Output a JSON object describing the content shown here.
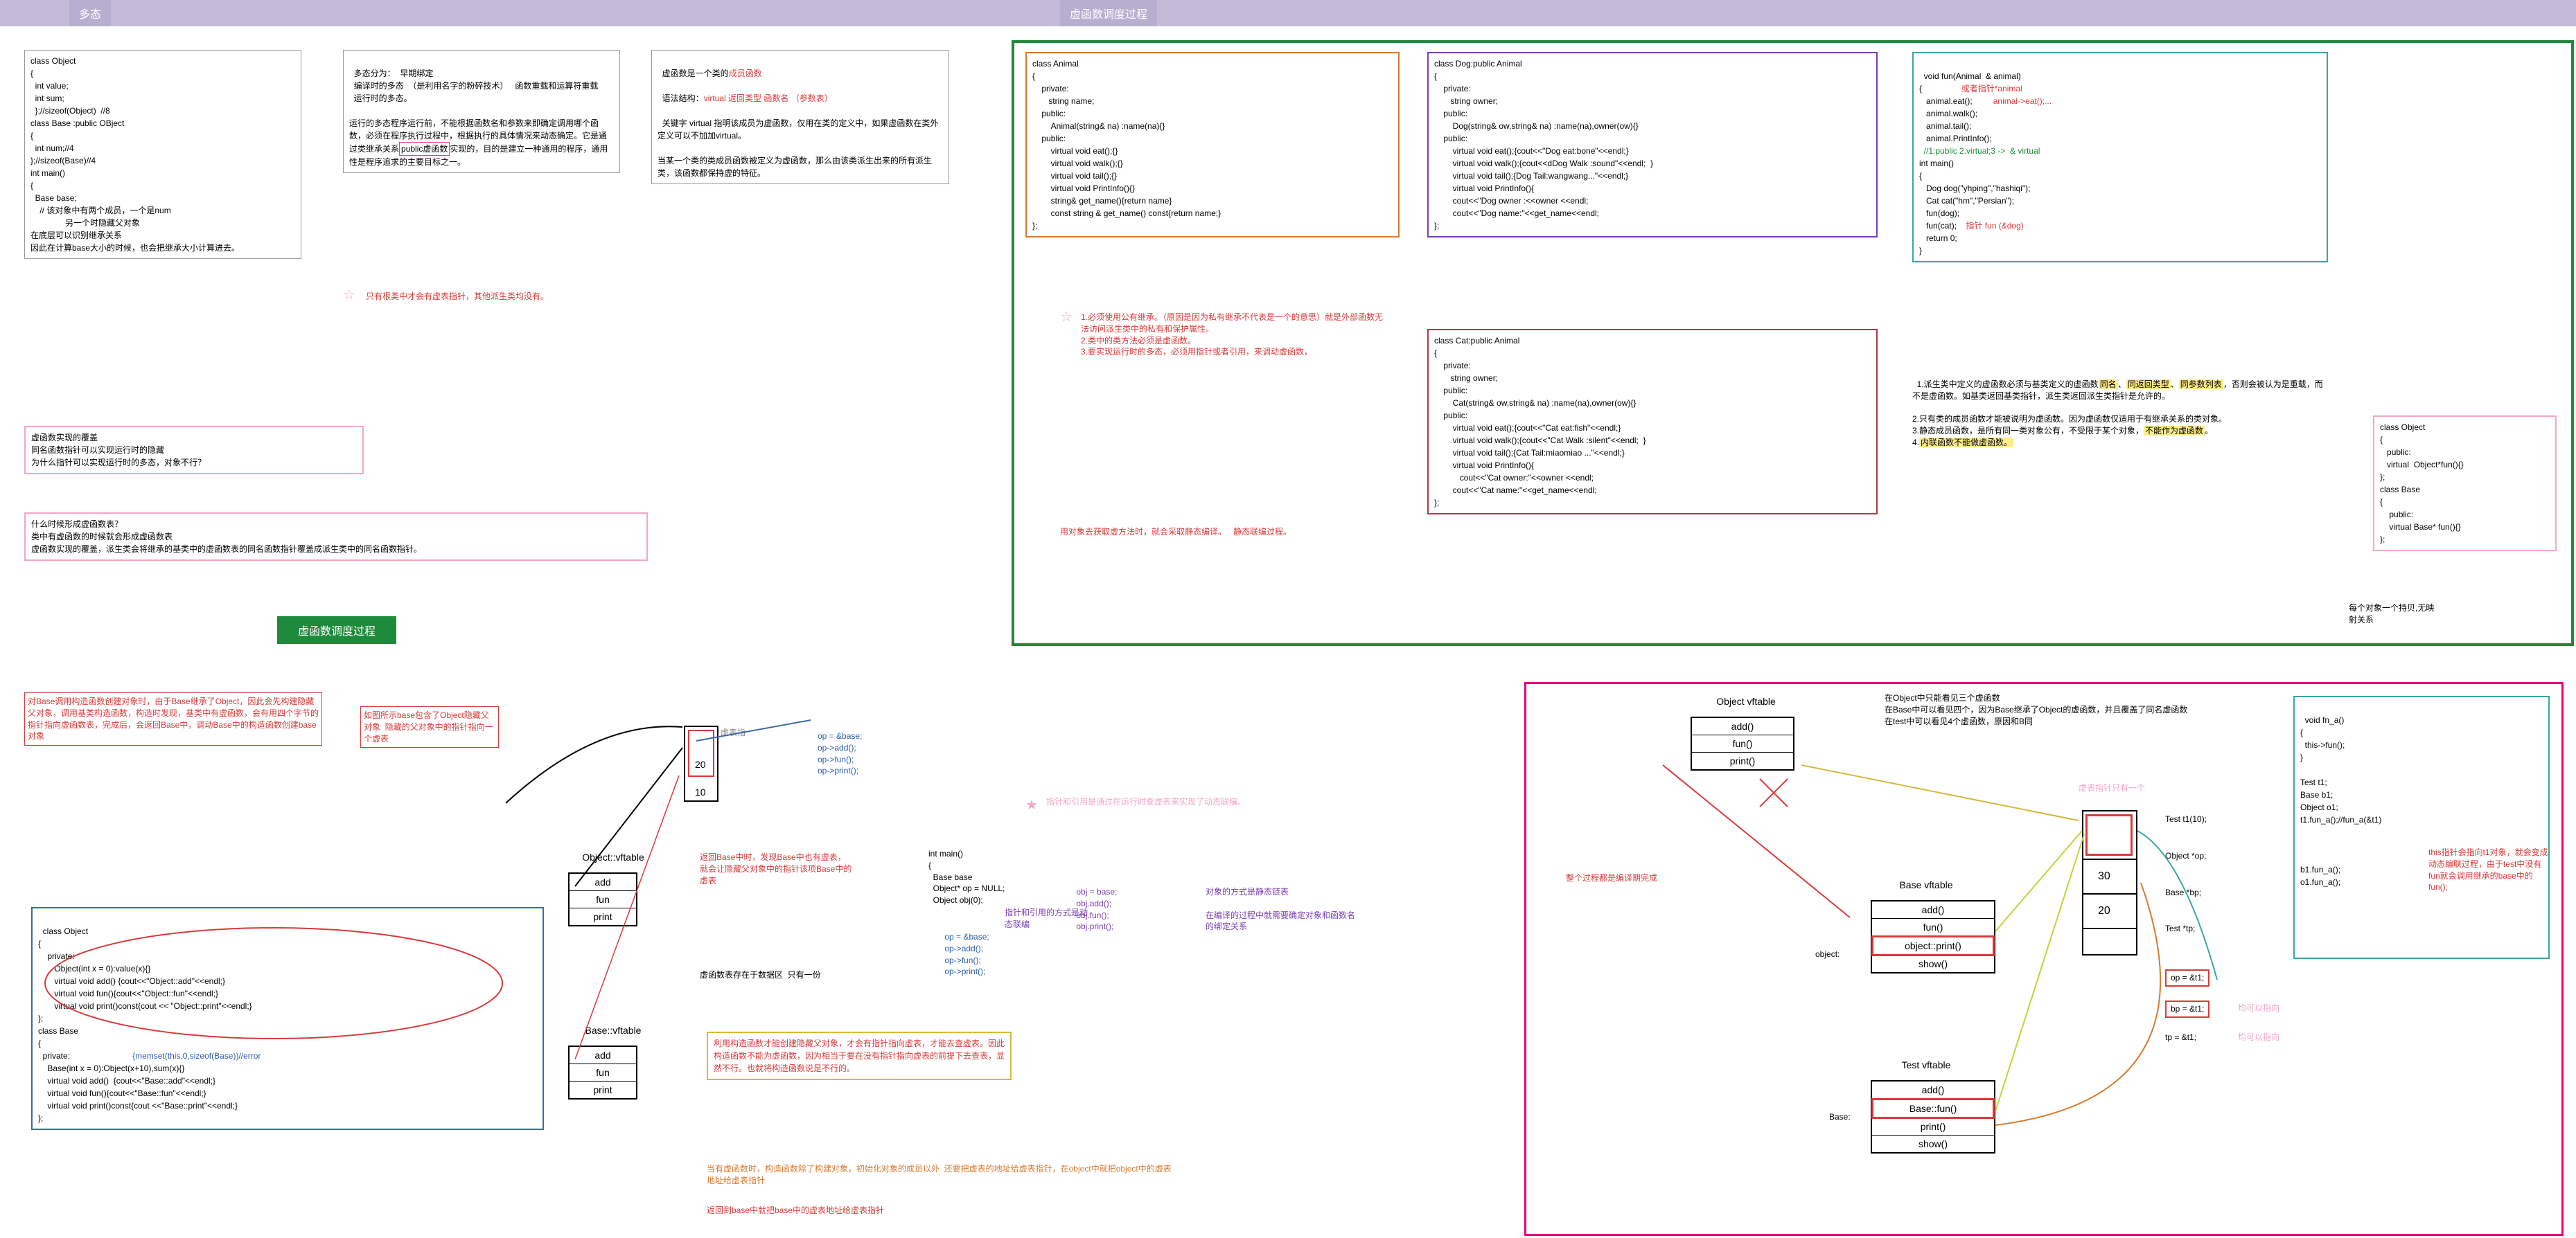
{
  "header": {
    "tab1": "多态",
    "tab2": "虚函数调度过程"
  },
  "topRow": {
    "box1": "class Object\n{\n  int value;\n  int sum;\n  };//sizeof(Object)  //8\nclass Base :public OBject\n{\n  int num;//4\n};//sizeof(Base)//4\nint main()\n{\n  Base base;\n    // 该对象中有两个成员，一个是num\n               另一个时隐藏父对象\n在底层可以识别继承关系\n因此在计算base大小的时候，也会把继承大小计算进去。",
    "box2_a": "多态分为：  早期绑定\n  编译时的多态  （是利用名字的粉碎技术）   函数重载和运算符重载\n  运行时的多态。\n\n运行的多态程序运行前，不能根据函数名和参数来即确定调用哪个函数，必须在程序执行过程中，根据执行的具体情况来动态确定。它是通过类继承关系",
    "box2_b": "public虚函数",
    "box2_c": "实现的，目的是建立一种通用的程序，通用性是程序追求的主要目标之一。",
    "box3_a": "虚函数是一个类的",
    "box3_b": "成员函数",
    "box3_c": "语法结构：",
    "box3_d": "virtual 返回类型 函数名 （参数表）",
    "box3_e": "关键字 virtual 指明该成员为虚函数，仅用在类的定义中，如果虚函数在类外定义可以不加加virtual。\n\n当某一个类的类成员函数被定义为虚函数，那么由该类派生出来的所有派生类，该函数都保持虚的特征。",
    "box4": "虚函数实现的覆盖\n同名函数指针可以实现运行时的隐藏\n为什么指针可以实现运行时的多态，对象不行？",
    "box5": "什么时候形成虚函数表？\n类中有虚函数的时候就会形成虚函数表\n虚函数实现的覆盖，派生类会将继承的基类中的虚函数表的同名函数指针覆盖成派生类中的同名函数指针。",
    "star1_text": "只有根类中才会有虚表指针，其他派生类均没有。"
  },
  "greenGroup": {
    "animal": "class Animal\n{\n    private:\n       string name;\n    public:\n        Animal(string& na) :name(na){}\n    public:\n        virtual void eat();{}\n        virtual void walk();{}\n        virtual void tail();{}\n        virtual void PrintInfo(){}\n        string& get_name(){return name}\n        const string & get_name() const{return name;}\n};",
    "dog": "class Dog:public Animal\n{\n    private:\n       string owner;\n    public:\n        Dog(string& ow,string& na) :name(na),owner(ow){}\n    public:\n        virtual void eat();{cout<<\"Dog eat:bone\"<<endl;}\n        virtual void walk();{cout<<dDog Walk :sound\"<<endl;  }\n        virtual void tail();{Dog Tail:wangwang...\"<<endl;}\n        virtual void PrintInfo(){\n        cout<<\"Dog owner :<<owner <<endl;\n        cout<<\"Dog name:\"<<get_name<<endl;\n};",
    "cat": "class Cat:public Animal\n{\n    private:\n       string owner;\n    public:\n        Cat(string& ow,string& na) :name(na),owner(ow){}\n    public:\n        virtual void eat();{cout<<\"Cat eat:fish\"<<endl;}\n        virtual void walk();{cout<<\"Cat Walk :silent\"<<endl;  }\n        virtual void tail();{Cat Tail:miaomiao ...\"<<endl;}\n        virtual void PrintInfo(){\n           cout<<\"Cat owner:\"<<owner <<endl;\n        cout<<\"Cat name:\"<<get_name<<endl;\n};",
    "fun_a": "void fun(Animal  & animal)\n{",
    "fun_ptr": "或者指针*animal",
    "fun_b": "   animal.eat();",
    "fun_ptr2": "animal->eat();...",
    "fun_c": "   animal.walk();\n   animal.tail();\n   animal.PrintInfo();",
    "fun_d": "//1:public 2.virtual;3 ->  & virtual",
    "fun_e": "int main()\n{\n   Dog dog(\"yhping\",\"hashiqi\");\n   Cat cat(\"hm\",\"Persian\");\n   fun(dog);\n   fun(cat);",
    "fun_f": "指针 fun (&dog)",
    "fun_g": "   return 0;\n}",
    "rules_a": "1.派生类中定义的虚函数必须与基类定义的虚函数",
    "rules_b": "同名",
    "rules_c": "同返回类型",
    "rules_d": "同参数列表",
    "rules_e": "否则会被认为是重载，而不是虚函数。如基类返回基类指针，派生类返回派生类指针是允许的。\n\n2.只有类的成员函数才能被说明为虚函数。因为虚函数仅适用于有继承关系的类对象。\n3.静态成员函数，是所有同一类对象公有，不受限于某个对象，",
    "rules_f": "不能作为虚函数",
    "rules_g": "\n4.",
    "rules_h": "内联函数不能做虚函数。",
    "rules_side": "每个对象一个持贝,无映射关系",
    "centerAnnot": "1.必须使用公有继承。（原因是因为私有继承不代表是一个的意思）就是外部函数无法访问派生类中的私有和保护属性。\n2.类中的类方法必须是虚函数。\n3.要实现运行时的多态，必须用指针或者引用，来调动虚函数，",
    "centerAnnot2": "用对象去获取虚方法时，就会采取静态编译。   静态联编过程。"
  },
  "rightSide": {
    "box": "class Object\n{\n   public:\n   virtual  Object*fun(){}\n};\nclass Base\n{\n    public:\n    virtual Base* fun(){}\n};"
  },
  "sectionLabel": "虚函数调度过程",
  "lowerLeft": {
    "redNote": "对Base调用构造函数创建对象时，由于Base继承了Object，因此会先构建隐藏父对象，调用基类构造函数，构造时发现，基类中有虚函数，会有用四个字节的指针指向虚函数表，完成后，会返回Base中，调动Base中的构造函数创建base对象",
    "redNote2": "如图所示base包含了Object隐藏父对象  隐藏的父对象中的指针指向一个虚表",
    "classCode_a": "class Object\n{\n    private:\n       Object(int x = 0):value(x){}\n       virtual void add() {cout<<\"Object::add\"<<endl;} \n       virtual void fun(){cout<<\"Object::fun\"<<endl;}\n       virtual void print()const{cout << \"Object::print\"<<endl;}\n};\nclass Base\n{\n  private:",
    "classCode_mem": "{memset(this,0,sizeof(Base))//error",
    "classCode_b": "    Base(int x = 0):Object(x+10),sum(x){}\n    virtual void add()  {cout<<\"Base::add\"<<endl;}\n    virtual void fun(){cout<<\"Base::fun\"<<endl;}\n    virtual void print()const{cout <<\"Base::print\"<<endl;}\n};",
    "vft1_title": "Object::vftable",
    "vft1_items": [
      "add",
      "fun",
      "print"
    ],
    "vft2_title": "Base::vftable",
    "vft2_items": [
      "add",
      "fun",
      "print"
    ],
    "vft_back": "返回Base中时，发现Base中也有虚表，就会让隐藏父对象中的指针该项Base中的虚表",
    "vtable_note1": "虚函数表存在于数据区  只有一份",
    "yellowBox": "利用构造函数才能创建隐藏父对象，才会有指针指向虚表，才能去查虚表。因此构造函数不能为虚函数，因为相当于要在没有指针指向虚表的前提下去查表，显然不行。也就将构造函数说是不行的。",
    "orangeText": "当有虚函数时，构造函数除了构建对象，初始化对象的成员以外  还要把虚表的地址给虚表指针，在object中就把object中的虚表地址给虚表指针",
    "orangeText2": "返回到base中就把base中的虚表地址给虚表指针",
    "mainCode": "int main()\n{\n  Base base\n  Object* op = NULL;\n  Object obj(0);",
    "mainCode2": "    op = &base;\n    op->add();\n    op->fun();\n    op->print();",
    "mainNote1": "    obj = base;\n    obj.add();\n    obj.fun();\n    obj.print();",
    "mainNote2": "对象的方式是静态链表\n\n在编译的过程中就需要确定对象和函数名的绑定关系",
    "mainNote_ptr": "指针和引用的方式是动态联编",
    "smallNums": "20",
    "smallNums2": "10",
    "opLabel": "op = &base;\nop->add();\nop->fun();\nop->print();",
    "vtable_hidden": "虚表指",
    "pinkStar": "指针和引用是通过在运行时查虚表来实现了动态联编。"
  },
  "lowerRight": {
    "vft_obj_title": "Object vftable",
    "vft_obj": [
      "add()",
      "fun()",
      "print()"
    ],
    "vft_base_title": "Base vftable",
    "vft_base": [
      "add()",
      "fun()",
      "object::print()",
      "show()"
    ],
    "vft_test_title": "Test vftable",
    "vft_test": [
      "add()",
      "Base::fun()",
      "print()",
      "show()"
    ],
    "topNote": "在Object中只能看见三个虚函数\n在Base中可以看见四个，因为Base继承了Object的虚函数，并且覆盖了同名虚函数\n在test中可以看见4个虚函数，原因和B同",
    "redNote": "整个过程都是编译期完成",
    "vptr_note": "虚表指针只有一个",
    "rects_vals": [
      "30",
      "20"
    ],
    "objDecl": "Test t1(10);\n\nObject *op;\n\nBase *bp;\n\nTest *tp;",
    "opAssign": "op = &t1;",
    "bpAssign": "bp = &t1;",
    "tpAssign": "tp = &t1;",
    "bpNote": "均可以指向",
    "tealBox": "void fn_a()\n{\n  this->fun();\n}\n\nTest t1;\nBase b1;\nObject o1;\nt1.fun_a();//fun_a(&t1)\n\n\n\nb1.fun_a();\no1.fun_a();",
    "tealBoxRed": "this指针会指向t1对象，就会变成动态编联过程，由于test中没有fun就会调用继承的base中的fun();"
  }
}
